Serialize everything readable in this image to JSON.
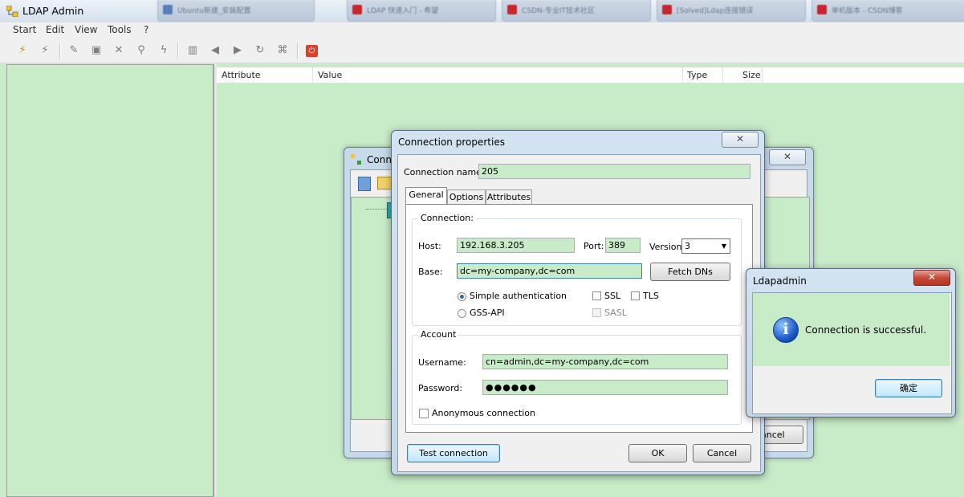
{
  "window": {
    "title": "LDAP Admin",
    "background_tabs": [
      "Ubuntu新建_安装配置",
      "LDAP 快速入门 - 希望",
      "CSDN-专业IT技术社区",
      "[Solved]Ldap连接错误",
      "单机版本 - CSDN博客"
    ]
  },
  "menu": [
    "Start",
    "Edit",
    "View",
    "Tools",
    "?"
  ],
  "list_columns": [
    "Attribute",
    "Value",
    "Type",
    "Size"
  ],
  "back_dialog": {
    "title_fragment": "Conn",
    "cancel_fragment": "ancel"
  },
  "connection_dialog": {
    "title": "Connection properties",
    "close_glyph": "✕",
    "connection_name_label": "Connection name:",
    "connection_name": "205",
    "tabs": [
      "General",
      "Options",
      "Attributes"
    ],
    "active_tab": "General",
    "connection_group": "Connection:",
    "host_label": "Host:",
    "host": "192.168.3.205",
    "port_label": "Port:",
    "port": "389",
    "version_label": "Version:",
    "version": "3",
    "base_label": "Base:",
    "base": "dc=my-company,dc=com",
    "fetch_dns": "Fetch DNs",
    "simple_auth": "Simple authentication",
    "gss_api": "GSS-API",
    "ssl": "SSL",
    "tls": "TLS",
    "sasl": "SASL",
    "account_group": "Account",
    "username_label": "Username:",
    "username": "cn=admin,dc=my-company,dc=com",
    "password_label": "Password:",
    "password": "●●●●●●",
    "anonymous": "Anonymous connection",
    "test_connection": "Test connection",
    "ok": "OK",
    "cancel": "Cancel"
  },
  "message_box": {
    "title": "Ldapadmin",
    "close_glyph": "✕",
    "message": "Connection is successful.",
    "icon_glyph": "i",
    "ok_button": "确定"
  },
  "colors": {
    "field_bg": "#c8ebc8",
    "pane_bg": "#c8ebc8",
    "accent": "#3c7fb1"
  }
}
